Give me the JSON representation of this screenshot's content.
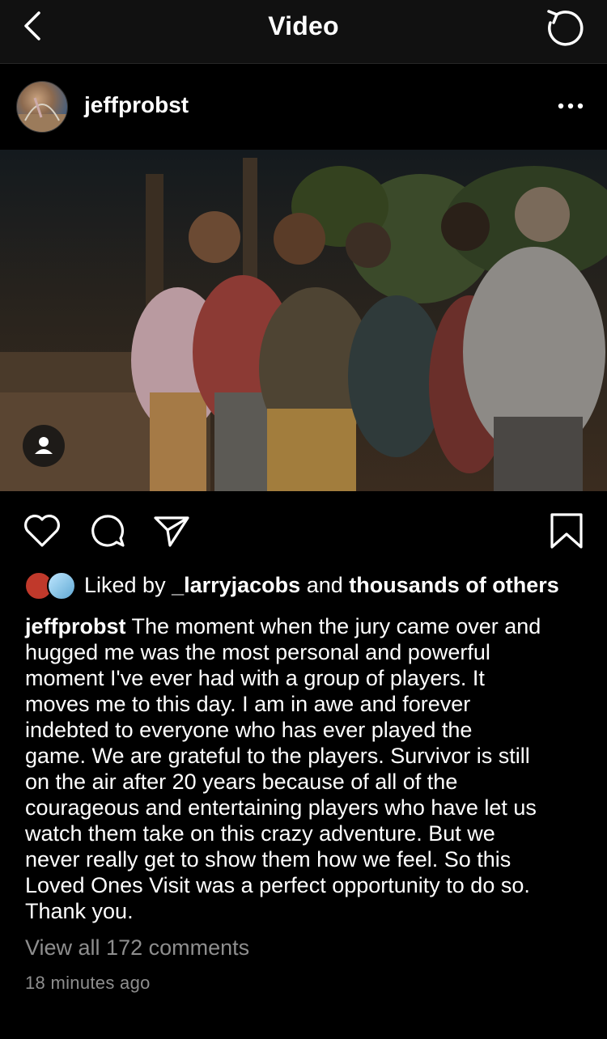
{
  "nav": {
    "title": "Video",
    "back_icon": "chevron-left-icon",
    "replay_icon": "replay-icon"
  },
  "post": {
    "username": "jeffprobst",
    "more_icon": "more-horizontal-icon"
  },
  "video": {
    "tag_icon": "person-tag-icon"
  },
  "actions": {
    "icons": [
      "heart-icon",
      "comment-icon",
      "share-icon",
      "bookmark-icon"
    ]
  },
  "likes": {
    "prefix": "Liked by ",
    "user": "_larryjacobs",
    "middle": " and ",
    "others": "thousands of others"
  },
  "caption": {
    "username": "jeffprobst",
    "lines": [
      "The moment when the jury came over and",
      "hugged me was the most personal and powerful",
      "moment I've ever had with a group of players. It",
      "moves me to this day. I am in awe and forever",
      "indebted to everyone who has ever played the",
      "game. We are grateful to the players. Survivor is still",
      "on the air after 20 years because of all of the",
      "courageous and entertaining players who have let us",
      "watch them take on this crazy adventure. But we",
      "never really get to show them how we feel. So this",
      "Loved Ones Visit was a perfect opportunity to do so.",
      "Thank you."
    ]
  },
  "comments": {
    "view_all": "View all 172 comments"
  },
  "timestamp": "18 minutes ago",
  "colors": {
    "background": "#000000",
    "navbar": "#111111",
    "secondary_text": "#8e8e8e"
  }
}
